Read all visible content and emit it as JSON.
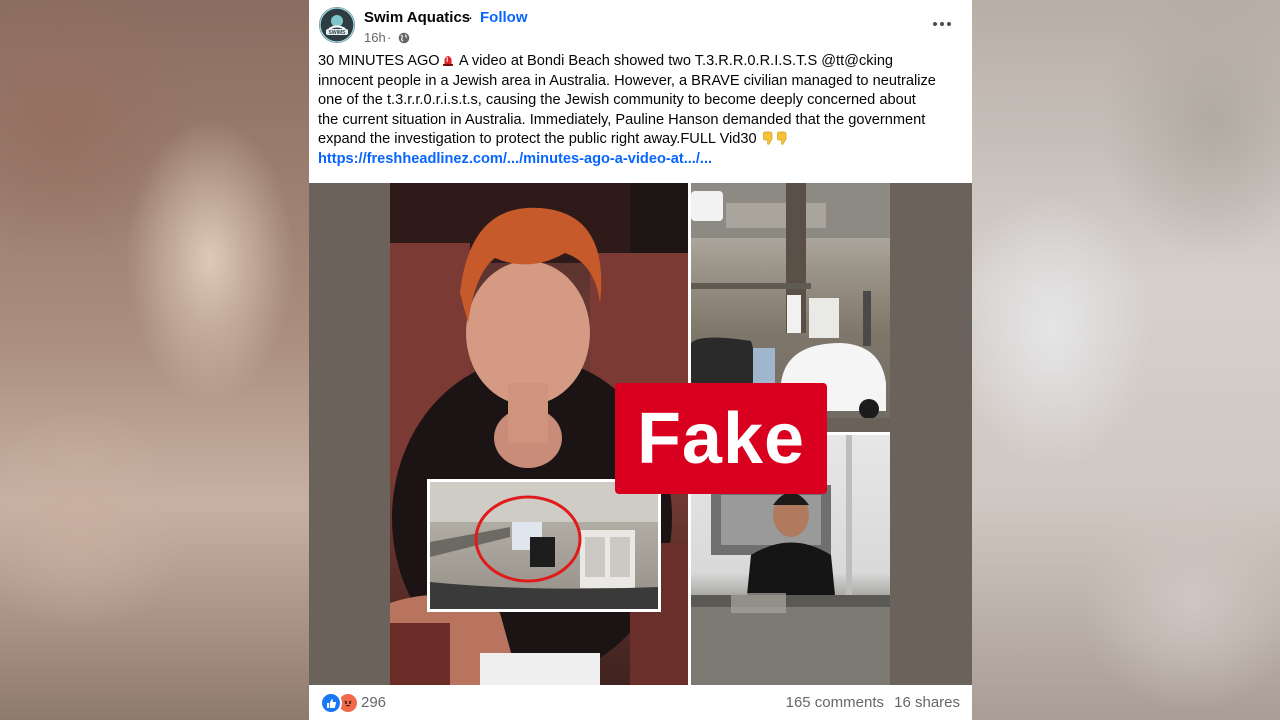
{
  "post": {
    "page_name": "Swim Aquatics",
    "separator": "·",
    "follow_label": "Follow",
    "time": "16h",
    "time_separator": "·",
    "avatar_text": "SWIMS",
    "caption": {
      "line1": "30 MINUTES AGO",
      "line1_rest": " A video at Bondi Beach showed two T.3.R.R.0.R.I.S.T.S @tt@cking",
      "line2": "innocent people in a Jewish area in Australia. However, a BRAVE civilian managed to neutralize",
      "line3": "one of the t.3.r.r.0.r.i.s.t.s, causing the Jewish community to become deeply concerned about",
      "line4": "the current situation in Australia. Immediately, Pauline Hanson demanded that the government",
      "line5": "expand the investigation to protect the public right away.FULL Vid30",
      "link": "https://freshheadlinez.com/.../minutes-ago-a-video-at.../..."
    },
    "overlay_label": "Fake",
    "reaction_count": "296",
    "comments": "165 comments",
    "shares": "16 shares"
  },
  "icons": {
    "siren": "siren-emoji",
    "point": "backhand-index-pointing-down-emoji",
    "globe": "globe-icon",
    "more": "more-horizontal-icon",
    "like": "like-reaction-icon",
    "angry": "angry-reaction-icon"
  },
  "colors": {
    "brand_blue": "#0866ff",
    "fake_red": "#d9001f",
    "secondary_text": "#65676b"
  }
}
